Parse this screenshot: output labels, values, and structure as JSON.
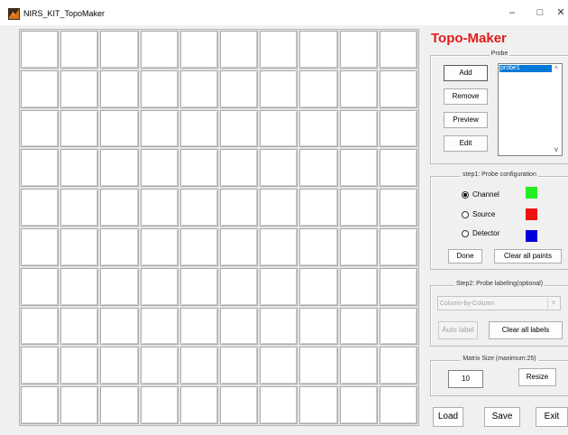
{
  "window": {
    "title": "NIRS_KIT_TopoMaker",
    "minimize": "–",
    "maximize": "□",
    "close": "✕"
  },
  "grid": {
    "rows": 10,
    "cols": 10
  },
  "app_title": "Topo-Maker",
  "probe_group": {
    "label": "Probe",
    "add": "Add",
    "remove": "Remove",
    "preview": "Preview",
    "edit": "Edit",
    "list": [
      "probe1"
    ],
    "scroll_up": "^",
    "scroll_down": "v"
  },
  "step1": {
    "label": "step1: Probe configuration",
    "channel": "Channel",
    "source": "Source",
    "detector": "Detector",
    "selected": "channel",
    "channel_color": "#22ee22",
    "source_color": "#ee1111",
    "detector_color": "#0000dd",
    "done": "Done",
    "clear_paints": "Clear all paints"
  },
  "step2": {
    "label": "Step2: Probe labeling(optional)",
    "select_value": "Column-by-Column",
    "select_arrow": "v",
    "auto_label": "Auto label",
    "clear_labels": "Clear all labels"
  },
  "matrix": {
    "label": "Matrix Size (maximum:25)",
    "value": "10",
    "resize": "Resize"
  },
  "footer": {
    "load": "Load",
    "save": "Save",
    "exit": "Exit"
  }
}
